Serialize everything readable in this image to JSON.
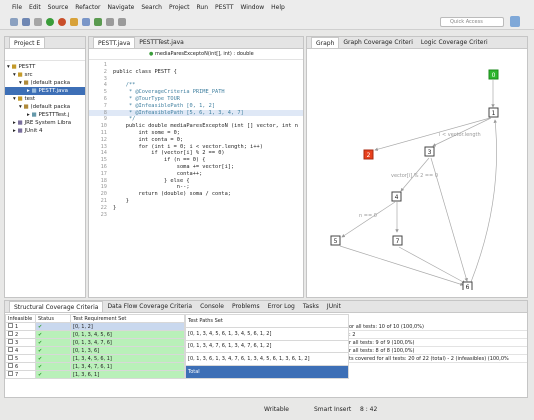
{
  "menu": [
    "File",
    "Edit",
    "Source",
    "Refactor",
    "Navigate",
    "Search",
    "Project",
    "Run",
    "PESTT",
    "Window",
    "Help"
  ],
  "quick_access": "Quick Access",
  "project_explorer": {
    "tab": "Project E",
    "tree": [
      "PESTT",
      "src",
      "(default packa",
      "PESTT.java",
      "test",
      "(default packa",
      "PESTTTest.j",
      "JRE System Libra",
      "JUnit 4"
    ]
  },
  "editor": {
    "tabs": [
      "PESTT.java",
      "PESTTTest.java"
    ],
    "breadcrumb": "mediaParesExceptoN(int[], int) : double",
    "lines": [
      {
        "n": "1",
        "t": ""
      },
      {
        "n": "2",
        "t": "public class PESTT {"
      },
      {
        "n": "3",
        "t": ""
      },
      {
        "n": "4",
        "t": "    /**"
      },
      {
        "n": "5",
        "t": "     * @CoverageCriteria PRIME_PATH"
      },
      {
        "n": "6",
        "t": "     * @TourType TOUR"
      },
      {
        "n": "7",
        "t": "     * @InfeasiblePath [0, 1, 2]"
      },
      {
        "n": "8",
        "t": "     * @InfeasiblePath [5, 6, 1, 3, 4, 7]"
      },
      {
        "n": "9",
        "t": "     */"
      },
      {
        "n": "10",
        "t": "    public double mediaParesExceptoN (int [] vector, int n"
      },
      {
        "n": "11",
        "t": "        int some = 0;"
      },
      {
        "n": "12",
        "t": "        int conta = 0;"
      },
      {
        "n": "13",
        "t": "        for (int i = 0; i < vector.length; i++)"
      },
      {
        "n": "14",
        "t": "            if (vector[i] % 2 == 0)"
      },
      {
        "n": "15",
        "t": "                if (n == 0) {"
      },
      {
        "n": "16",
        "t": "                    soma += vector[i];"
      },
      {
        "n": "17",
        "t": "                    conta++;"
      },
      {
        "n": "18",
        "t": "                } else {"
      },
      {
        "n": "19",
        "t": "                    n--;"
      },
      {
        "n": "20",
        "t": "        return (double) soma / conta;"
      },
      {
        "n": "21",
        "t": "    }"
      },
      {
        "n": "22",
        "t": "}"
      },
      {
        "n": "23",
        "t": ""
      }
    ]
  },
  "graph": {
    "tabs": [
      "Graph",
      "Graph Coverage Criteri",
      "Logic Coverage Criteri"
    ],
    "nodes": [
      "0",
      "1",
      "2",
      "3",
      "4",
      "5",
      "6",
      "7"
    ],
    "edge_labels": [
      "i < vector.length",
      "vector[i] % 2 == 0",
      "n == 0"
    ],
    "colors": {
      "start": "#2db52d",
      "selected": "#e8401c",
      "normal": "#ffffff",
      "edge": "#999999"
    }
  },
  "bottom": {
    "tabs": [
      "Structural Coverage Criteria",
      "Data Flow Coverage Criteria",
      "Console",
      "Problems",
      "Error Log",
      "Tasks",
      "JUnit"
    ],
    "req_headers": [
      "Infeasible",
      "Status",
      "Test Requirement Set"
    ],
    "requirements": [
      {
        "n": "1",
        "path": "[0, 1, 2]"
      },
      {
        "n": "2",
        "path": "[0, 1, 3, 4, 5, 6]"
      },
      {
        "n": "3",
        "path": "[0, 1, 3, 4, 7, 6]"
      },
      {
        "n": "4",
        "path": "[0, 1, 3, 6]"
      },
      {
        "n": "5",
        "path": "[1, 3, 4, 5, 6, 1]"
      },
      {
        "n": "6",
        "path": "[1, 3, 4, 7, 6, 1]"
      },
      {
        "n": "7",
        "path": "[1, 3, 6, 1]"
      }
    ],
    "test_paths_header": "Test Paths Set",
    "test_paths": [
      "[0, 1, 3, 4, 5, 6, 1, 3, 4, 5, 6, 1, 2]",
      "[0, 1, 3, 4, 7, 6, 1, 3, 4, 7, 6, 1, 2]",
      "[0, 1, 3, 6, 1, 3, 4, 7, 6, 1, 3, 4, 5, 6, 1, 3, 6, 1, 2]",
      "Total"
    ],
    "stats": [
      "or all tests: 10 of 10 (100,0%)",
      ": 2",
      "r all tests: 9 of 9 (100,0%)",
      "r all tests: 8 of 8 (100,0%)",
      "ts covered for all tests: 20 of 22 (total) - 2 (infeasibles) (100,0%"
    ]
  },
  "status": {
    "mode": "Writable",
    "insert": "Smart Insert",
    "pos": "8 : 42"
  }
}
